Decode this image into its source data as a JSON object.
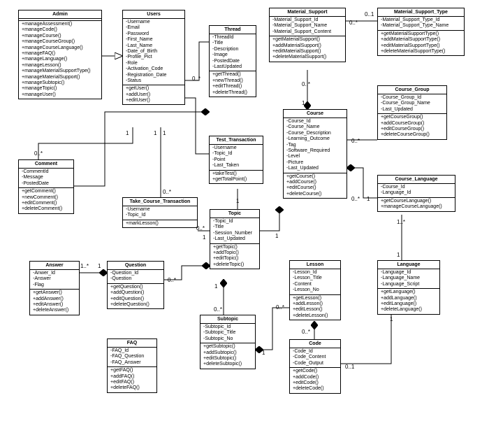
{
  "classes": {
    "Admin": {
      "name": "Admin",
      "attrs": [],
      "ops": [
        "+manageAssessment()",
        "+manageCode()",
        "+manageCourse()",
        "+manageCourseGroup()",
        "+manageCourseLanguage()",
        "+manageFAQ()",
        "+manageLanguage()",
        "+manageLesson()",
        "+manageMaterialSupportType()",
        "+manageMaterialSupport()",
        "+manageSubtopic()",
        "+manageTopic()",
        "+manageUser()"
      ]
    },
    "Users": {
      "name": "Users",
      "attrs": [
        "-Username",
        "-Email",
        "-Password",
        "-First_Name",
        "-Last_Name",
        "-Date_of_Birth",
        "-Profile_Pict",
        "-Role",
        "-Activation_Code",
        "-Registration_Date",
        "-Status"
      ],
      "ops": [
        "+getUser()",
        "+addUser()",
        "+editUser()"
      ]
    },
    "Thread": {
      "name": "Thread",
      "attrs": [
        "-ThreadId",
        "-Title",
        "-Description",
        "-Image",
        "-PostedDate",
        "-LastUpdated"
      ],
      "ops": [
        "+getThread()",
        "+newThread()",
        "+editThread()",
        "+deleteThread()"
      ]
    },
    "Material_Support": {
      "name": "Material_Support",
      "attrs": [
        "-Material_Support_Id",
        "-Material_Support_Name",
        "-Material_Support_Content"
      ],
      "ops": [
        "+getMaterialSupport()",
        "+addMaterialSupport()",
        "+editMaterialSupport()",
        "+deleteMaterialSupport()"
      ]
    },
    "Material_Support_Type": {
      "name": "Material_Support_Type",
      "attrs": [
        "-Material_Support_Type_Id",
        "-Material_Support_Type_Name"
      ],
      "ops": [
        "+getMaterialSupportType()",
        "+addMaterialSupportType()",
        "+editMaterialSupportType()",
        "+deleteMaterialSupportType()"
      ]
    },
    "Comment": {
      "name": "Comment",
      "attrs": [
        "-CommentId",
        "-Message",
        "-PostedDate"
      ],
      "ops": [
        "+getComment()",
        "+newComment()",
        "+editComment()",
        "+deleteComment()"
      ]
    },
    "Take_Course_Transaction": {
      "name": "Take_Course_Transaction",
      "attrs": [
        "-Username",
        "-Topic_Id"
      ],
      "ops": [
        "+markLesson()"
      ]
    },
    "Test_Transaction": {
      "name": "Test_Transaction",
      "attrs": [
        "-Username",
        "-Topic_Id",
        "-Point",
        "-Last_Taken"
      ],
      "ops": [
        "+takeTest()",
        "+getTotalPoint()"
      ]
    },
    "Course": {
      "name": "Course",
      "attrs": [
        "-Course_Id",
        "-Course_Name",
        "-Course_Description",
        "-Learning_Outcome",
        "-Tag",
        "-Software_Required",
        "-Level",
        "-Picture",
        "-Last_Updated"
      ],
      "ops": [
        "+getCourse()",
        "+addCourse()",
        "+editCourse()",
        "+deleteCourse()"
      ]
    },
    "Course_Group": {
      "name": "Course_Group",
      "attrs": [
        "-Course_Group_Id",
        "-Course_Group_Name",
        "-Last_Updated"
      ],
      "ops": [
        "+getCourseGroup()",
        "+addCourseGroup()",
        "+editCourseGroup()",
        "+deleteCourseGroup()"
      ]
    },
    "Course_Language": {
      "name": "Course_Language",
      "attrs": [
        "-Course_Id",
        "-Language_Id"
      ],
      "ops": [
        "+getCourseLanguage()",
        "+manageCourseLanguage()"
      ]
    },
    "Topic": {
      "name": "Topic",
      "attrs": [
        "-Topic_Id",
        "-Title",
        "-Session_Number",
        "-Last_Updated"
      ],
      "ops": [
        "+getTopic()",
        "+addTopic()",
        "+editTopic()",
        "+deleteTopic()"
      ]
    },
    "Answer": {
      "name": "Answer",
      "attrs": [
        "-Anwer_Id",
        "-Answer",
        "-Flag"
      ],
      "ops": [
        "+getAnswer()",
        "+addAnswer()",
        "+editAnswer()",
        "+deleteAnswer()"
      ]
    },
    "Question": {
      "name": "Question",
      "attrs": [
        "-Question_Id",
        "-Question"
      ],
      "ops": [
        "+getQuestion()",
        "+addQuestion()",
        "+editQuestion()",
        "+deleteQuestion()"
      ]
    },
    "Lesson": {
      "name": "Lesson",
      "attrs": [
        "-Lesson_Id",
        "-Lesson_Title",
        "-Content",
        "-Lesson_No"
      ],
      "ops": [
        "+getLesson()",
        "+addLesson()",
        "+editLesson()",
        "+deleteLesson()"
      ]
    },
    "Language": {
      "name": "Language",
      "attrs": [
        "-Language_Id",
        "-Language_Name",
        "-Language_Script"
      ],
      "ops": [
        "+getLanguage()",
        "+addLanguage()",
        "+editLanguage()",
        "+deleteLanguage()"
      ]
    },
    "FAQ": {
      "name": "FAQ",
      "attrs": [
        "-FAQ_Id",
        "-FAQ_Question",
        "-FAQ_Answer"
      ],
      "ops": [
        "+getFAQ()",
        "+addFAQ()",
        "+editFAQ()",
        "+deleteFAQ()"
      ]
    },
    "Subtopic": {
      "name": "Subtopic",
      "attrs": [
        "-Subtopic_Id",
        "-Subtopic_Title",
        "-Subtopic_No"
      ],
      "ops": [
        "+getSubtopic()",
        "+addSubtopic()",
        "+editSubtopic()",
        "+deleteSubtopic()"
      ]
    },
    "Code": {
      "name": "Code",
      "attrs": [
        "-Code_Id",
        "-Code_Content",
        "-Code_Output"
      ],
      "ops": [
        "+getCode()",
        "+addCode()",
        "+editCode()",
        "+deleteCode()"
      ]
    }
  },
  "multiplicities": {
    "m1": "0..*",
    "m2": "1",
    "m3": "1..*",
    "m4": "0..1",
    "m5": "0..*",
    "m6": "1",
    "m7": "1",
    "m8": "1",
    "m9": "0..*",
    "m10": "1",
    "m11": "0..*",
    "m12": "1",
    "m13": "1",
    "m14": "0..*",
    "m15": "0..*",
    "m16": "1",
    "m17": "1",
    "m18": "0..*",
    "m19": "0..*",
    "m20": "1",
    "m21": "0..1",
    "m22": "0..*",
    "m23": "1"
  },
  "chart_data": {
    "type": "uml_class_diagram",
    "relationships": [
      {
        "from": "Admin",
        "to": "Users",
        "type": "generalization"
      },
      {
        "from": "Users",
        "to": "Comment",
        "type": "association",
        "mult_from": "1",
        "mult_to": "0..*"
      },
      {
        "from": "Users",
        "to": "Thread",
        "type": "association",
        "mult_from": "1",
        "mult_to": "0..*"
      },
      {
        "from": "Users",
        "to": "Take_Course_Transaction",
        "type": "association",
        "mult_from": "1",
        "mult_to": "0..*"
      },
      {
        "from": "Users",
        "to": "Test_Transaction",
        "type": "association",
        "mult_from": "1",
        "mult_to": "0..*"
      },
      {
        "from": "Thread",
        "to": "Comment",
        "type": "composition",
        "mult_from": "1",
        "mult_to": "0..*"
      },
      {
        "from": "Material_Support",
        "to": "Material_Support_Type",
        "type": "association",
        "mult_from": "0..*",
        "mult_to": "0..1"
      },
      {
        "from": "Course",
        "to": "Material_Support",
        "type": "composition",
        "mult_from": "1",
        "mult_to": "0..*"
      },
      {
        "from": "Course",
        "to": "Course_Group",
        "type": "association",
        "mult_from": "0..*",
        "mult_to": "1"
      },
      {
        "from": "Course",
        "to": "Course_Language",
        "type": "composition",
        "mult_from": "1",
        "mult_to": "0..*"
      },
      {
        "from": "Course",
        "to": "Topic",
        "type": "composition",
        "mult_from": "1",
        "mult_to": "0..*"
      },
      {
        "from": "Course_Language",
        "to": "Language",
        "type": "association",
        "mult_from": "1..*",
        "mult_to": "1"
      },
      {
        "from": "Topic",
        "to": "Test_Transaction",
        "type": "association",
        "mult_from": "1",
        "mult_to": "0..*"
      },
      {
        "from": "Topic",
        "to": "Take_Course_Transaction",
        "type": "association",
        "mult_from": "1",
        "mult_to": "0..*"
      },
      {
        "from": "Topic",
        "to": "Subtopic",
        "type": "composition",
        "mult_from": "1",
        "mult_to": "0..*"
      },
      {
        "from": "Topic",
        "to": "Question",
        "type": "composition",
        "mult_from": "1",
        "mult_to": "0..*"
      },
      {
        "from": "Subtopic",
        "to": "Lesson",
        "type": "composition",
        "mult_from": "1",
        "mult_to": "0..*"
      },
      {
        "from": "Lesson",
        "to": "Code",
        "type": "composition",
        "mult_from": "1",
        "mult_to": "0..*"
      },
      {
        "from": "Code",
        "to": "Language",
        "type": "association",
        "mult_from": "0..1",
        "mult_to": "1"
      },
      {
        "from": "Question",
        "to": "Answer",
        "type": "composition",
        "mult_from": "1",
        "mult_to": "1..*"
      }
    ]
  }
}
